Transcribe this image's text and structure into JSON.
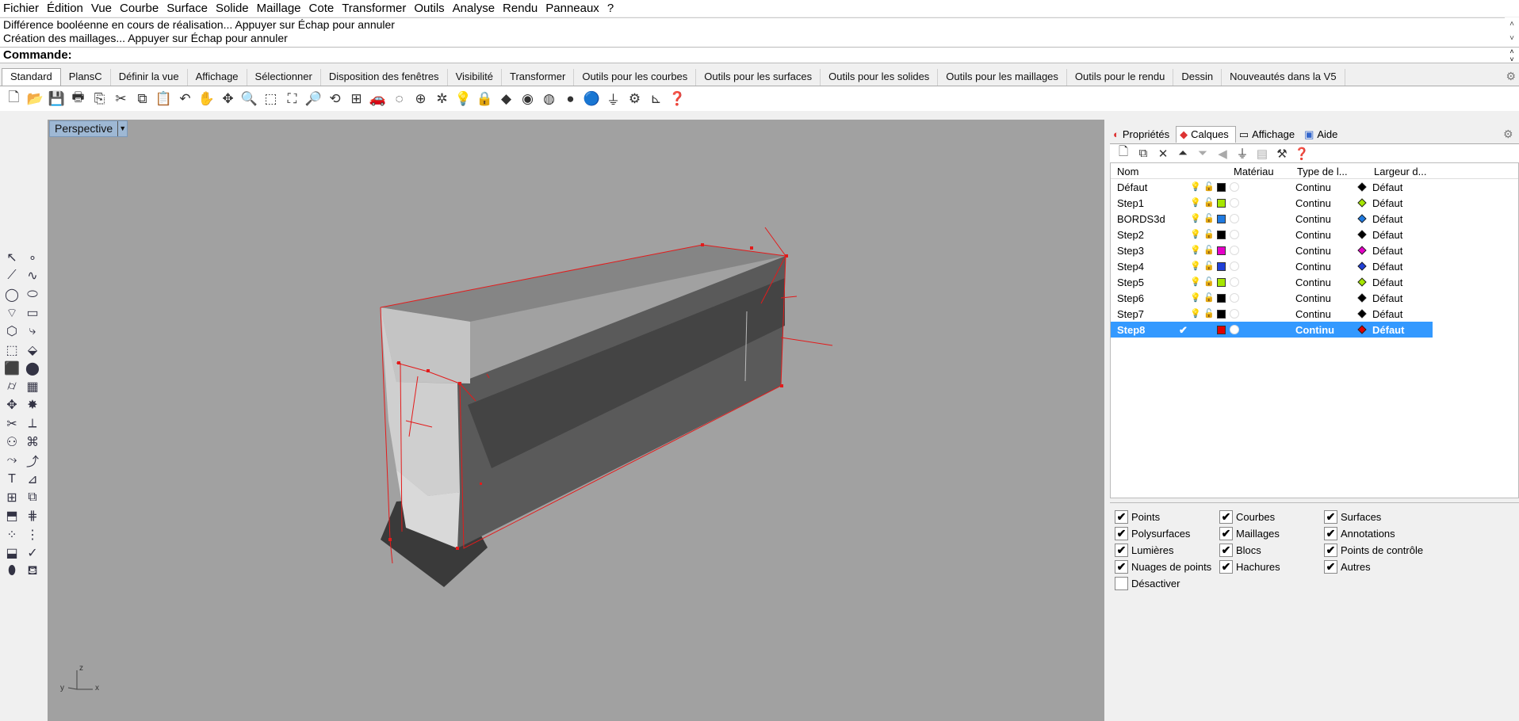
{
  "menu": [
    "Fichier",
    "Édition",
    "Vue",
    "Courbe",
    "Surface",
    "Solide",
    "Maillage",
    "Cote",
    "Transformer",
    "Outils",
    "Analyse",
    "Rendu",
    "Panneaux",
    "?"
  ],
  "history": [
    "Différence booléenne en cours de réalisation... Appuyer sur Échap pour annuler",
    "Création des maillages... Appuyer sur Échap pour annuler"
  ],
  "command": {
    "label": "Commande:"
  },
  "tabs": [
    "Standard",
    "PlansC",
    "Définir la vue",
    "Affichage",
    "Sélectionner",
    "Disposition des fenêtres",
    "Visibilité",
    "Transformer",
    "Outils pour les courbes",
    "Outils pour les surfaces",
    "Outils pour les solides",
    "Outils pour les maillages",
    "Outils pour le rendu",
    "Dessin",
    "Nouveautés dans la V5"
  ],
  "toolbar_icons": [
    "new-file-icon",
    "open-folder-icon",
    "save-icon",
    "print-icon",
    "import-icon",
    "cut-icon",
    "copy-icon",
    "paste-icon",
    "undo-icon",
    "pan-hand-icon",
    "rotate-view-icon",
    "zoom-icon",
    "zoom-window-icon",
    "zoom-extents-icon",
    "zoom-selected-icon",
    "undo-view-icon",
    "four-viewports-icon",
    "car-icon",
    "hide-icon",
    "grid-snap-icon",
    "lights-icon",
    "bulb-icon",
    "lock-icon",
    "layer-icon",
    "color-wheel-icon",
    "wireframe-sphere-icon",
    "shaded-sphere-icon",
    "rendered-sphere-icon",
    "select-filter-icon",
    "options-gear-icon",
    "dimension-icon",
    "help-icon"
  ],
  "viewport": {
    "title": "Perspective"
  },
  "panel": {
    "tabs": [
      "Propriétés",
      "Calques",
      "Affichage",
      "Aide"
    ],
    "active_tab": "Calques",
    "columns": {
      "name": "Nom",
      "material": "Matériau",
      "linetype": "Type de l...",
      "width": "Largeur d..."
    },
    "layers": [
      {
        "name": "Défaut",
        "color": "#000000",
        "linetype": "Continu",
        "width": "Défaut",
        "wcolor": "#000000",
        "current": false
      },
      {
        "name": "Step1",
        "color": "#a6e600",
        "linetype": "Continu",
        "width": "Défaut",
        "wcolor": "#a6e600",
        "current": false
      },
      {
        "name": "BORDS3d",
        "color": "#1f7ae0",
        "linetype": "Continu",
        "width": "Défaut",
        "wcolor": "#1f7ae0",
        "current": false
      },
      {
        "name": "Step2",
        "color": "#000000",
        "linetype": "Continu",
        "width": "Défaut",
        "wcolor": "#000000",
        "current": false
      },
      {
        "name": "Step3",
        "color": "#e600c8",
        "linetype": "Continu",
        "width": "Défaut",
        "wcolor": "#e600c8",
        "current": false
      },
      {
        "name": "Step4",
        "color": "#1f3fd6",
        "linetype": "Continu",
        "width": "Défaut",
        "wcolor": "#1f3fd6",
        "current": false
      },
      {
        "name": "Step5",
        "color": "#a6e600",
        "linetype": "Continu",
        "width": "Défaut",
        "wcolor": "#a6e600",
        "current": false
      },
      {
        "name": "Step6",
        "color": "#000000",
        "linetype": "Continu",
        "width": "Défaut",
        "wcolor": "#000000",
        "current": false
      },
      {
        "name": "Step7",
        "color": "#000000",
        "linetype": "Continu",
        "width": "Défaut",
        "wcolor": "#000000",
        "current": false
      },
      {
        "name": "Step8",
        "color": "#e00000",
        "linetype": "Continu",
        "width": "Défaut",
        "wcolor": "#e00000",
        "current": true
      }
    ],
    "filters": [
      {
        "label": "Points",
        "checked": true
      },
      {
        "label": "Courbes",
        "checked": true
      },
      {
        "label": "Surfaces",
        "checked": true
      },
      {
        "label": "Polysurfaces",
        "checked": true
      },
      {
        "label": "Maillages",
        "checked": true
      },
      {
        "label": "Annotations",
        "checked": true
      },
      {
        "label": "Lumières",
        "checked": true
      },
      {
        "label": "Blocs",
        "checked": true
      },
      {
        "label": "Points de contrôle",
        "checked": true
      },
      {
        "label": "Nuages de points",
        "checked": true
      },
      {
        "label": "Hachures",
        "checked": true
      },
      {
        "label": "Autres",
        "checked": true
      },
      {
        "label": "Désactiver",
        "checked": false
      }
    ]
  },
  "axes": {
    "z": "z",
    "y": "y",
    "x": "x"
  }
}
